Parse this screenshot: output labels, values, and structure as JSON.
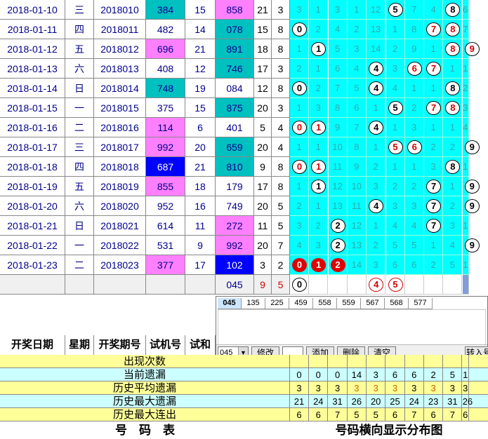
{
  "rows": [
    {
      "date": "2018-01-10",
      "week": "三",
      "issue": "2018010",
      "test": "384",
      "test_bg": "teal",
      "sum": "15",
      "draw": "858",
      "draw_bg": "pink",
      "a": "21",
      "b": "3",
      "dist": [
        "3",
        "1",
        "3",
        "1",
        "12",
        "@5",
        "7",
        "4",
        "@8",
        "6"
      ]
    },
    {
      "date": "2018-01-11",
      "week": "四",
      "issue": "2018011",
      "test": "482",
      "test_bg": "",
      "sum": "14",
      "draw": "078",
      "draw_bg": "teal",
      "a": "15",
      "b": "8",
      "dist": [
        "@0",
        "2",
        "4",
        "2",
        "13",
        "1",
        "8",
        "r7",
        "r8",
        "7"
      ]
    },
    {
      "date": "2018-01-12",
      "week": "五",
      "issue": "2018012",
      "test": "696",
      "test_bg": "pink",
      "sum": "21",
      "draw": "891",
      "draw_bg": "teal",
      "a": "18",
      "b": "8",
      "dist": [
        "1",
        "@1",
        "5",
        "3",
        "14",
        "2",
        "9",
        "1",
        "r8",
        "r9"
      ]
    },
    {
      "date": "2018-01-13",
      "week": "六",
      "issue": "2018013",
      "test": "408",
      "test_bg": "",
      "sum": "12",
      "draw": "746",
      "draw_bg": "teal",
      "a": "17",
      "b": "3",
      "dist": [
        "2",
        "1",
        "6",
        "4",
        "@4",
        "3",
        "r6",
        "r7",
        "1",
        "1"
      ]
    },
    {
      "date": "2018-01-14",
      "week": "日",
      "issue": "2018014",
      "test": "748",
      "test_bg": "teal",
      "sum": "19",
      "draw": "084",
      "draw_bg": "",
      "a": "12",
      "b": "8",
      "dist": [
        "@0",
        "2",
        "7",
        "5",
        "@4",
        "4",
        "1",
        "1",
        "@8",
        "2"
      ]
    },
    {
      "date": "2018-01-15",
      "week": "一",
      "issue": "2018015",
      "test": "375",
      "test_bg": "",
      "sum": "15",
      "draw": "875",
      "draw_bg": "teal",
      "a": "20",
      "b": "3",
      "dist": [
        "1",
        "3",
        "8",
        "6",
        "1",
        "@5",
        "2",
        "r7",
        "r8",
        "3"
      ]
    },
    {
      "date": "2018-01-16",
      "week": "二",
      "issue": "2018016",
      "test": "114",
      "test_bg": "pink",
      "sum": "6",
      "draw": "401",
      "draw_bg": "",
      "a": "5",
      "b": "4",
      "dist": [
        "r0",
        "r1",
        "9",
        "7",
        "@4",
        "1",
        "3",
        "1",
        "1",
        "4"
      ]
    },
    {
      "date": "2018-01-17",
      "week": "三",
      "issue": "2018017",
      "test": "992",
      "test_bg": "pink",
      "sum": "20",
      "draw": "659",
      "draw_bg": "teal",
      "a": "20",
      "b": "4",
      "dist": [
        "1",
        "1",
        "10",
        "8",
        "1",
        "r5",
        "r6",
        "2",
        "2",
        "@9"
      ]
    },
    {
      "date": "2018-01-18",
      "week": "四",
      "issue": "2018018",
      "test": "687",
      "test_bg": "blue",
      "sum": "21",
      "draw": "810",
      "draw_bg": "teal",
      "a": "9",
      "b": "8",
      "dist": [
        "r0",
        "r1",
        "11",
        "9",
        "2",
        "1",
        "1",
        "3",
        "@8",
        "1"
      ]
    },
    {
      "date": "2018-01-19",
      "week": "五",
      "issue": "2018019",
      "test": "855",
      "test_bg": "pink",
      "sum": "18",
      "draw": "179",
      "draw_bg": "",
      "a": "17",
      "b": "8",
      "dist": [
        "1",
        "@1",
        "12",
        "10",
        "3",
        "2",
        "2",
        "@7",
        "1",
        "@9"
      ]
    },
    {
      "date": "2018-01-20",
      "week": "六",
      "issue": "2018020",
      "test": "952",
      "test_bg": "",
      "sum": "16",
      "draw": "749",
      "draw_bg": "",
      "a": "20",
      "b": "5",
      "dist": [
        "2",
        "1",
        "13",
        "11",
        "@4",
        "3",
        "3",
        "@7",
        "2",
        "@9"
      ]
    },
    {
      "date": "2018-01-21",
      "week": "日",
      "issue": "2018021",
      "test": "614",
      "test_bg": "",
      "sum": "11",
      "draw": "272",
      "draw_bg": "pink",
      "a": "11",
      "b": "5",
      "dist": [
        "3",
        "2",
        "@2",
        "12",
        "1",
        "4",
        "4",
        "@7",
        "3",
        "1"
      ]
    },
    {
      "date": "2018-01-22",
      "week": "一",
      "issue": "2018022",
      "test": "531",
      "test_bg": "",
      "sum": "9",
      "draw": "992",
      "draw_bg": "pink",
      "a": "20",
      "b": "7",
      "dist": [
        "4",
        "3",
        "@2",
        "13",
        "2",
        "5",
        "5",
        "1",
        "4",
        "@9"
      ]
    },
    {
      "date": "2018-01-23",
      "week": "二",
      "issue": "2018023",
      "test": "377",
      "test_bg": "pink",
      "sum": "17",
      "draw": "102",
      "draw_bg": "blue",
      "a": "3",
      "b": "2",
      "dist": [
        "s0",
        "s1",
        "s2",
        "14",
        "3",
        "6",
        "6",
        "2",
        "5",
        "1"
      ]
    }
  ],
  "edit_row": {
    "draw": "045",
    "a": "9",
    "b": "5",
    "balls": [
      "@0",
      "",
      "",
      "",
      "o4",
      "o5",
      "",
      "",
      "",
      ""
    ]
  },
  "panel": {
    "tabs": [
      "045",
      "135",
      "225",
      "459",
      "558",
      "559",
      "567",
      "568",
      "577"
    ],
    "select_value": "045",
    "btn_modify": "修改",
    "btn_add": "添加",
    "btn_delete": "删除",
    "btn_clear": "清空",
    "btn_import": "转入号"
  },
  "headers": {
    "date": "开奖日期",
    "week": "星期",
    "issue": "开奖期号",
    "test": "试机号",
    "sum": "试和"
  },
  "stats": [
    {
      "label": "出现次数",
      "values": [],
      "cls": "y"
    },
    {
      "label": "当前遗漏",
      "values": [
        "0",
        "0",
        "0",
        "14",
        "3",
        "6",
        "6",
        "2",
        "5",
        "1"
      ],
      "cls": "cy"
    },
    {
      "label": "历史平均遗漏",
      "values": [
        "3",
        "3",
        "3",
        "3",
        "3",
        "3",
        "3",
        "3",
        "3",
        "3"
      ],
      "cls": "y"
    },
    {
      "label": "历史最大遗漏",
      "values": [
        "21",
        "24",
        "31",
        "26",
        "20",
        "25",
        "24",
        "23",
        "31",
        "26"
      ],
      "cls": "cy"
    },
    {
      "label": "历史最大连出",
      "values": [
        "6",
        "6",
        "7",
        "5",
        "5",
        "6",
        "7",
        "6",
        "7",
        "6"
      ],
      "cls": "y"
    }
  ],
  "footer": {
    "left": "号　码　表",
    "right": "号码横向显示分布图"
  }
}
